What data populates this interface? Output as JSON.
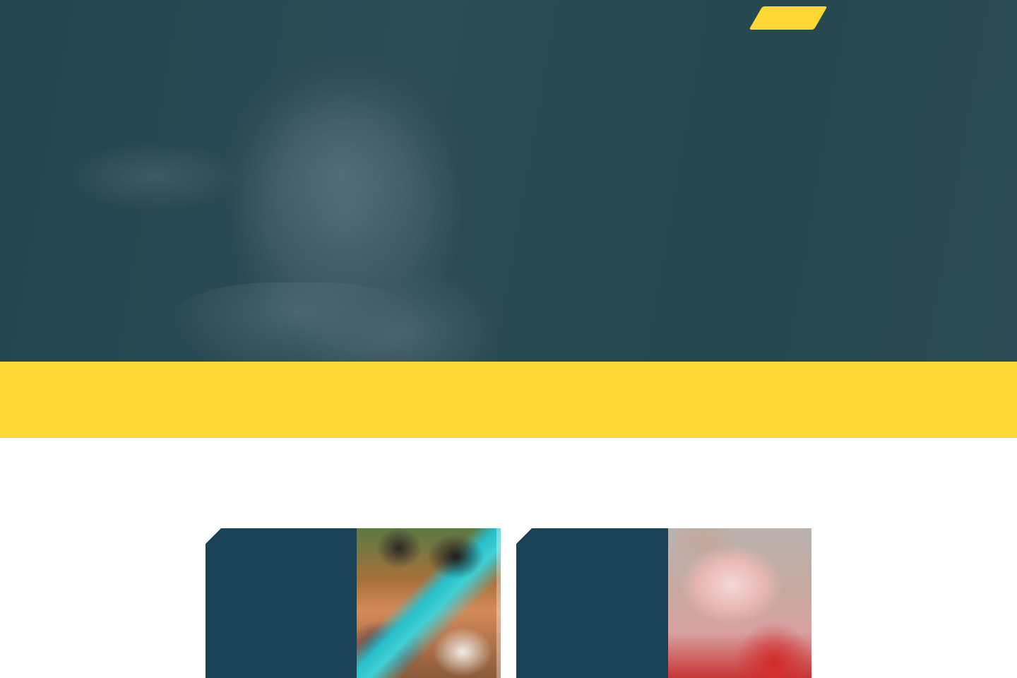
{
  "hero": {
    "cta_label": "",
    "headline_line1": "",
    "headline_line2_left": "",
    "headline_line2_right": ""
  },
  "band": {
    "text": ""
  },
  "cards": [
    {
      "label": ""
    },
    {
      "label": ""
    }
  ],
  "colors": {
    "hero_bg": "#27484f",
    "accent_yellow": "#fdd835",
    "card_panel": "#1b4156",
    "text_light": "#f1f5f6"
  },
  "icons": {
    "cta": "none"
  }
}
